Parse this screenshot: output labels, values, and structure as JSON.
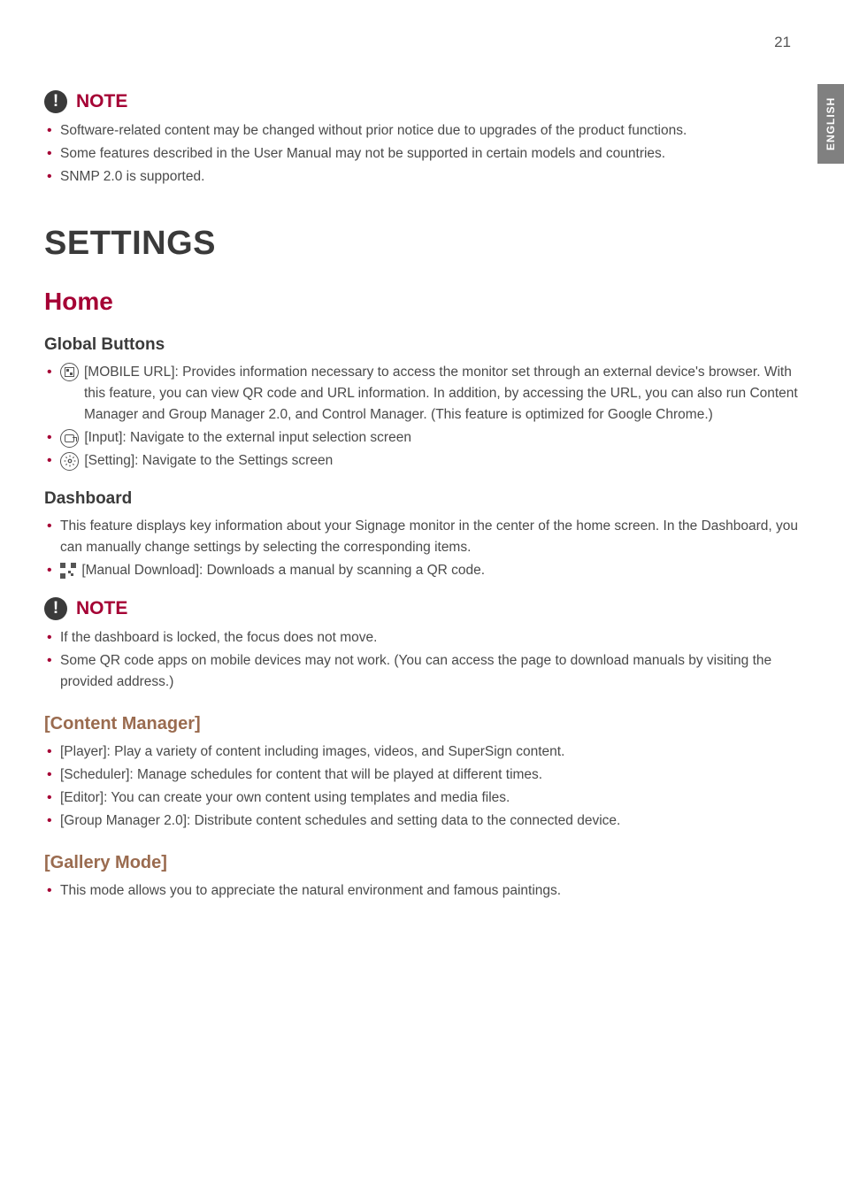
{
  "page_number": "21",
  "side_tab": "ENGLISH",
  "note_label": "NOTE",
  "notes_top": {
    "items": [
      "Software-related content may be changed without prior notice due to upgrades of the product functions.",
      "Some features described in the User Manual may not be supported in certain models and countries.",
      "SNMP 2.0 is supported."
    ]
  },
  "settings_heading": "SETTINGS",
  "home_heading": "Home",
  "global_buttons": {
    "heading": "Global Buttons",
    "mobile_url": "[MOBILE URL]: Provides information necessary to access the monitor set through an external device's browser. With this feature, you can view QR code and URL information. In addition, by accessing the URL, you can also run Content Manager and Group Manager 2.0, and Control Manager. (This feature is optimized for Google Chrome.)",
    "input": "[Input]: Navigate to the external input selection screen",
    "setting": "[Setting]: Navigate to the Settings screen"
  },
  "dashboard": {
    "heading": "Dashboard",
    "item1": "This feature displays key information about your Signage monitor in the center of the home screen. In the Dashboard, you can manually change settings by selecting the corresponding items.",
    "item2": "[Manual Download]: Downloads a manual by scanning a QR code."
  },
  "notes_mid": {
    "items": [
      "If the dashboard is locked, the focus does not move.",
      "Some QR code apps on mobile devices may not work. (You can access the page to download manuals by visiting the provided address.)"
    ]
  },
  "content_manager": {
    "heading": "[Content Manager]",
    "items": [
      "[Player]: Play a variety of content including images, videos, and SuperSign content.",
      "[Scheduler]: Manage schedules for content that will be played at different times.",
      "[Editor]: You can create your own content using templates and media files.",
      "[Group Manager 2.0]: Distribute content schedules and setting data to the connected device."
    ]
  },
  "gallery_mode": {
    "heading": "[Gallery Mode]",
    "item": "This mode allows you to appreciate the natural environment and famous paintings."
  }
}
